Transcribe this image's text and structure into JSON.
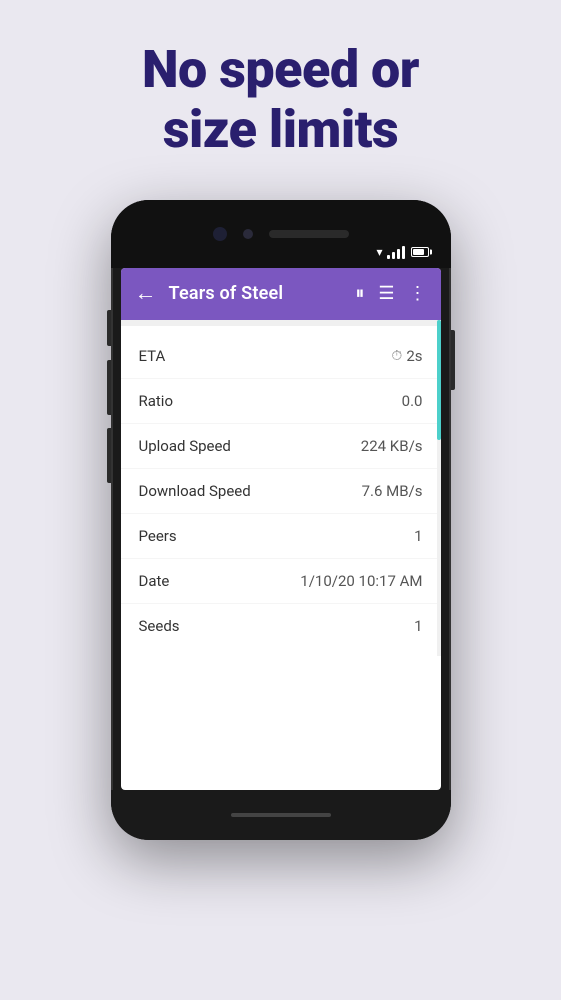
{
  "headline": {
    "line1": "No speed or",
    "line2": "size limits"
  },
  "app": {
    "toolbar": {
      "back_icon": "←",
      "title": "Tears of Steel",
      "pause_icon": "⏸",
      "list_icon": "☰",
      "more_icon": "⋮"
    },
    "info_rows": [
      {
        "label": "ETA",
        "value": "2s",
        "has_clock": true
      },
      {
        "label": "Ratio",
        "value": "0.0",
        "has_clock": false
      },
      {
        "label": "Upload Speed",
        "value": "224 KB/s",
        "has_clock": false
      },
      {
        "label": "Download Speed",
        "value": "7.6 MB/s",
        "has_clock": false
      },
      {
        "label": "Peers",
        "value": "1",
        "has_clock": false
      },
      {
        "label": "Date",
        "value": "1/10/20 10:17 AM",
        "has_clock": false
      },
      {
        "label": "Seeds",
        "value": "1",
        "has_clock": false
      }
    ]
  },
  "colors": {
    "background": "#eae8f0",
    "headline": "#2a1f6e",
    "toolbar_bg": "#7b57c0",
    "progress_color": "#4dd0cb"
  }
}
